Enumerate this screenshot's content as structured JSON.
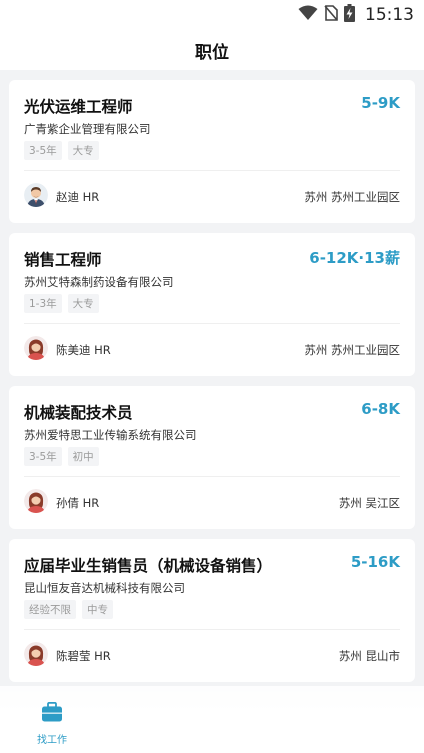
{
  "status_bar": {
    "time": "15:13",
    "icons": [
      "wifi-icon",
      "no-sim-icon",
      "battery-charging-icon"
    ]
  },
  "header": {
    "title": "职位"
  },
  "jobs": [
    {
      "title": "光伏运维工程师",
      "salary": "5-9K",
      "company": "广青紫企业管理有限公司",
      "tags": [
        "3-5年",
        "大专"
      ],
      "hr": "赵迪 HR",
      "avatar": "male-avatar",
      "location": "苏州  苏州工业园区"
    },
    {
      "title": "销售工程师",
      "salary": "6-12K·13薪",
      "company": "苏州艾特森制药设备有限公司",
      "tags": [
        "1-3年",
        "大专"
      ],
      "hr": "陈美迪 HR",
      "avatar": "female-avatar",
      "location": "苏州  苏州工业园区"
    },
    {
      "title": "机械装配技术员",
      "salary": "6-8K",
      "company": "苏州爱特思工业传输系统有限公司",
      "tags": [
        "3-5年",
        "初中"
      ],
      "hr": "孙倩 HR",
      "avatar": "female-avatar",
      "location": "苏州  吴江区"
    },
    {
      "title": "应届毕业生销售员（机械设备销售）",
      "salary": "5-16K",
      "company": "昆山恒友音达机械科技有限公司",
      "tags": [
        "经验不限",
        "中专"
      ],
      "hr": "陈碧莹 HR",
      "avatar": "female-avatar",
      "location": "苏州  昆山市"
    }
  ],
  "tab_bar": {
    "items": [
      {
        "label": "找工作",
        "icon": "briefcase-icon",
        "active": true
      }
    ]
  },
  "colors": {
    "accent": "#2d9cc6",
    "background": "#f2f3f5",
    "card": "#ffffff",
    "tag_bg": "#f3f4f6"
  }
}
